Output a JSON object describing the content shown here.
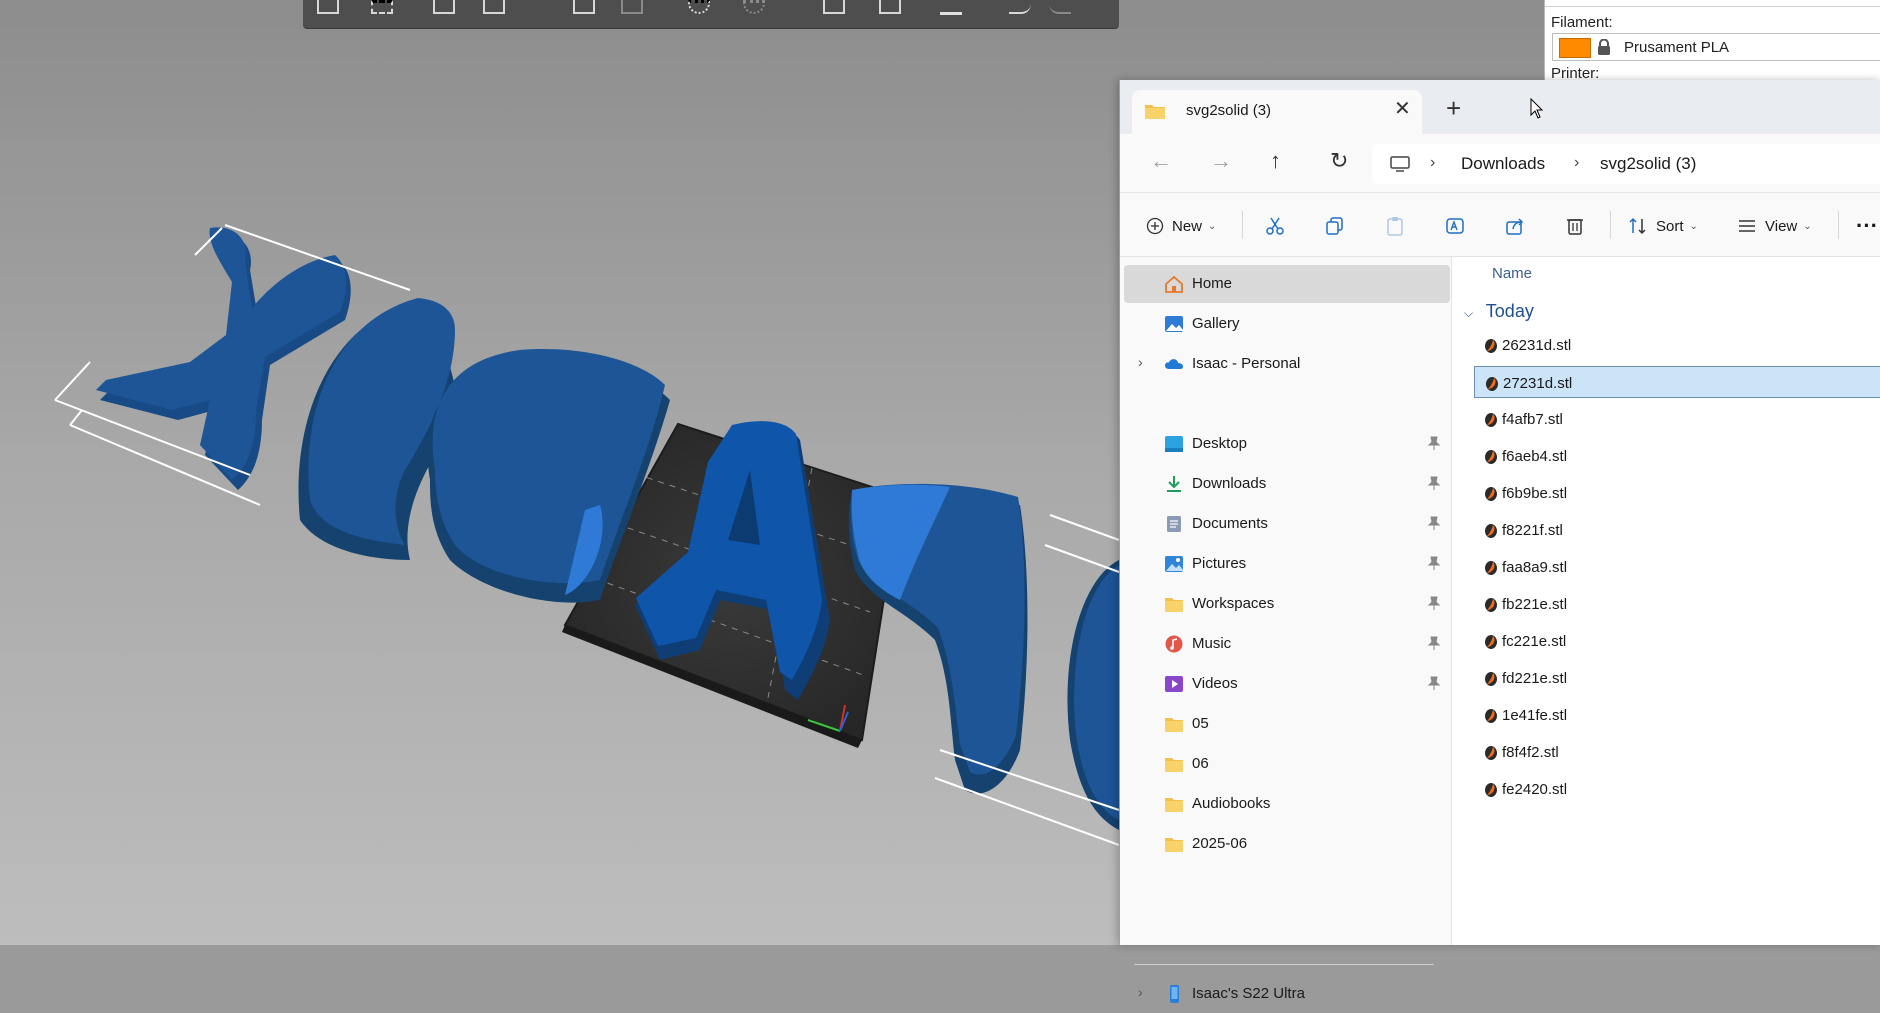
{
  "sidebar": {
    "filament_label": "Filament:",
    "filament_value": "Prusament PLA",
    "filament_color": "#ff8a00",
    "printer_label": "Printer:"
  },
  "explorer": {
    "tab_title": "svg2solid (3)",
    "breadcrumbs": [
      "Downloads",
      "svg2solid (3)"
    ],
    "commands": {
      "new_label": "New",
      "sort_label": "Sort",
      "view_label": "View",
      "more_label": "···"
    },
    "nav_items": [
      {
        "label": "Home",
        "icon": "home-icon",
        "color": "#e8792b"
      },
      {
        "label": "Gallery",
        "icon": "gallery-icon",
        "color": "#2f7bd6"
      },
      {
        "label": "Isaac - Personal",
        "icon": "onedrive-icon",
        "color": "#1f7ad3"
      },
      {
        "label": "Desktop",
        "icon": "desktop-icon",
        "color": "#2aa3e0"
      },
      {
        "label": "Downloads",
        "icon": "download-icon",
        "color": "#1e9c5a"
      },
      {
        "label": "Documents",
        "icon": "documents-icon",
        "color": "#8a9bb5"
      },
      {
        "label": "Pictures",
        "icon": "pictures-icon",
        "color": "#2f86d8"
      },
      {
        "label": "Workspaces",
        "icon": "folder-icon",
        "color": "#f2c14b"
      },
      {
        "label": "Music",
        "icon": "music-icon",
        "color": "#e2564a"
      },
      {
        "label": "Videos",
        "icon": "videos-icon",
        "color": "#8b45c9"
      },
      {
        "label": "05",
        "icon": "folder-icon",
        "color": "#f2c14b"
      },
      {
        "label": "06",
        "icon": "folder-icon",
        "color": "#f2c14b"
      },
      {
        "label": "Audiobooks",
        "icon": "folder-icon",
        "color": "#f2c14b"
      },
      {
        "label": "2025-06",
        "icon": "folder-icon",
        "color": "#f2c14b"
      },
      {
        "label": "Isaac's S22 Ultra",
        "icon": "phone-icon",
        "color": "#2a7fd4"
      }
    ],
    "column_name": "Name",
    "group_label": "Today",
    "files": [
      "26231d.stl",
      "27231d.stl",
      "f4afb7.stl",
      "f6aeb4.stl",
      "f6b9be.stl",
      "f8221f.stl",
      "faa8a9.stl",
      "fb221e.stl",
      "fc221e.stl",
      "fd221e.stl",
      "1e41fe.stl",
      "f8f4f2.stl",
      "fe2420.stl"
    ],
    "selected_file": "27231d.stl"
  },
  "viewport": {
    "model_color": "#1d5597",
    "model_highlight": "#2f7ad6",
    "bed_color": "#2f2f2f"
  }
}
